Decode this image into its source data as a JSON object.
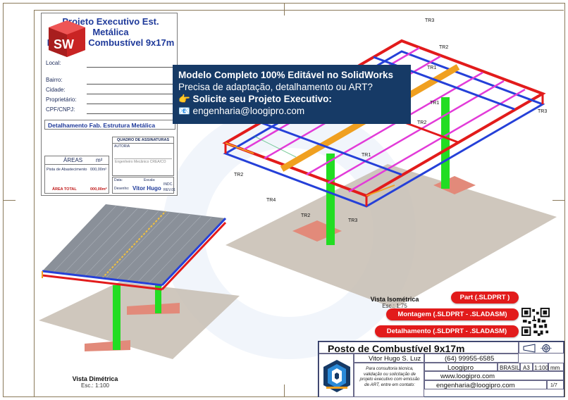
{
  "form": {
    "title_line1": "Projeto Executivo Est. Metálica",
    "title_line2": "Posto de Combustível 9x17m",
    "field_local": "Local:",
    "field_bairro": "Bairro:",
    "field_cidade": "Cidade:",
    "field_proprietario": "Proprietário:",
    "field_cpf": "CPF/CNPJ:",
    "detail_title": "Detalhamento Fab. Estrutura Metálica",
    "areas_title": "ÁREAS",
    "areas_unit": "m²",
    "area_row_label": "Pista de Abastecimento",
    "area_row_value": "000,00m²",
    "area_total_label": "ÁREA TOTAL",
    "area_total_value": "000,00m²",
    "signatures_title": "QUADRO DE ASSINATURAS",
    "sign_autoria": "AUTORIA",
    "sign_engineer": "Engenheiro Mecânico CREA/CO",
    "meta_data": "Data:",
    "meta_escala": "Escala:",
    "meta_escala_value": "INDC.",
    "meta_desenho": "Desenho:",
    "meta_designer": "Vitor Hugo",
    "meta_rev": "REV.01"
  },
  "logo": {
    "letters": "SW"
  },
  "banner": {
    "line1": "Modelo Completo 100% Editável no SolidWorks",
    "line2": "Precisa de adaptação, detalhamento ou ART?",
    "line3": "👉 Solicite seu Projeto Executivo:",
    "line4": "📧 engenharia@loogipro.com"
  },
  "labels": {
    "tr1": "TR1",
    "tr2": "TR2",
    "tr3": "TR3",
    "tr4": "TR4"
  },
  "views": {
    "iso_name": "Vista Isométrica",
    "iso_scale": "Esc.: 1:75",
    "dim_name": "Vista Dimétrica",
    "dim_scale": "Esc.: 1:100"
  },
  "pills": {
    "part": "Part (.SLDPRT )",
    "montagem": "Montagem (.SLDPRT - .SLADASM)",
    "detalhamento": "Detalhamento (.SLDPRT - .SLADASM)"
  },
  "title_block": {
    "project": "Posto de Combustível 9x17m",
    "designer": "Vitor Hugo S. Luz",
    "phone": "(64) 99955-6585",
    "company": "Loogipro",
    "country": "BRASIL",
    "format": "A3",
    "scale": "1:100",
    "unit": "mm",
    "website": "www.loogipro.com",
    "email": "engenharia@loogipro.com",
    "sheet": "1/7",
    "note": "Para consultoria técnica, validação ou solicitação de projeto executivo com emissão de ART, entre em contato:"
  },
  "colors": {
    "navy": "#163a66",
    "red": "#e21b1b",
    "green": "#22dd22",
    "magenta": "#e23bd8",
    "orange": "#f0a020",
    "blue": "#2540d8"
  }
}
